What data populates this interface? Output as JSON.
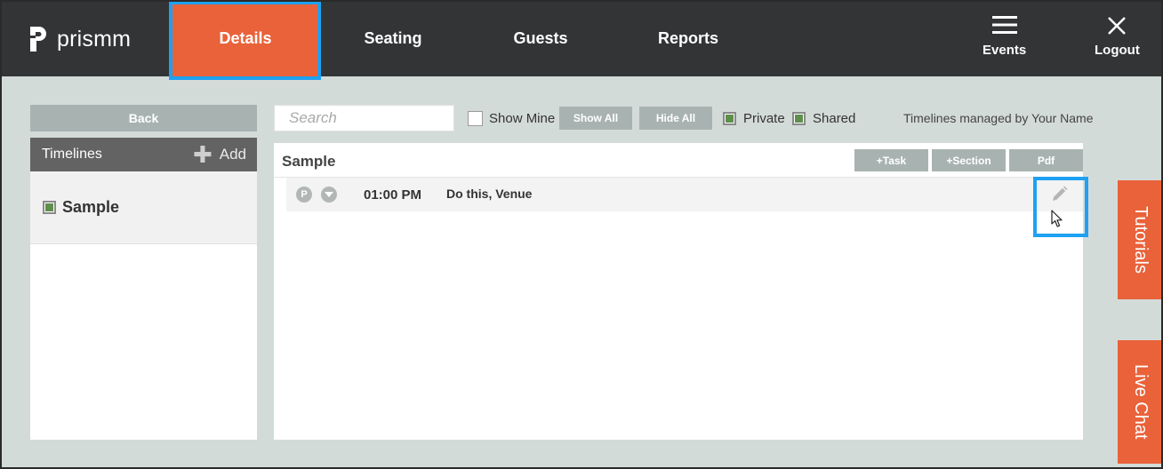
{
  "header": {
    "logo_text": "prismm",
    "tabs": [
      {
        "label": "Details",
        "active": true
      },
      {
        "label": "Seating",
        "active": false
      },
      {
        "label": "Guests",
        "active": false
      },
      {
        "label": "Reports",
        "active": false
      }
    ],
    "events_label": "Events",
    "logout_label": "Logout"
  },
  "sidebar": {
    "back_label": "Back",
    "timelines_label": "Timelines",
    "add_label": "Add",
    "items": [
      {
        "label": "Sample",
        "checked": true
      }
    ]
  },
  "toolbar": {
    "search_placeholder": "Search",
    "show_mine_label": "Show Mine",
    "show_all_label": "Show All",
    "hide_all_label": "Hide All",
    "private_label": "Private",
    "shared_label": "Shared",
    "managed_text": "Timelines managed by Your Name"
  },
  "main": {
    "title": "Sample",
    "task_button": "+Task",
    "section_button": "+Section",
    "pdf_button": "Pdf",
    "tasks": [
      {
        "badge": "P",
        "time": "01:00 PM",
        "description": "Do this, Venue"
      }
    ]
  },
  "side_tabs": {
    "tutorials": "Tutorials",
    "live_chat": "Live Chat"
  },
  "colors": {
    "accent": "#e9623a",
    "header_bg": "#333436",
    "page_bg": "#d3dbd9",
    "button_gray": "#a8b3b1",
    "highlight": "#1ea1f2",
    "check_green": "#5f8f4c"
  }
}
